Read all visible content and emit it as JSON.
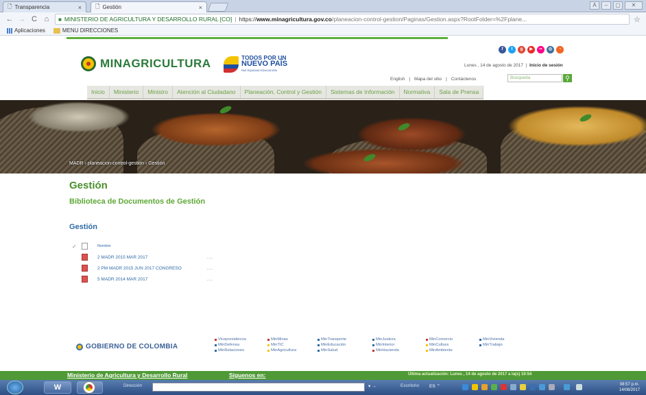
{
  "browser": {
    "tabs": [
      {
        "label": "Transparencia",
        "close": "×"
      },
      {
        "label": "Gestión",
        "close": "×"
      }
    ],
    "window_controls": [
      "A",
      "–",
      "▢",
      "✕"
    ],
    "nav": {
      "back": "←",
      "forward": "→",
      "reload": "C",
      "home": "⌂"
    },
    "site_name": "MINISTERIO DE AGRICULTURA Y DESARROLLO RURAL [CO]",
    "separator": "|",
    "url_scheme": "https://",
    "url_host": "www.minagricultura.gov.co",
    "url_path": "/planeacion-control-gestion/Paginas/Gestion.aspx?RootFolder=%2Fplane...",
    "bookmark_star": "☆",
    "bookmarks": [
      {
        "label": "Aplicaciones"
      },
      {
        "label": "MENU DIRECCIONES"
      }
    ]
  },
  "header": {
    "logo_text": "MINAGRICULTURA",
    "todos_line1": "TODOS POR UN",
    "todos_line2": "NUEVO PAÍS",
    "todos_line3": "PAZ EQUIDAD EDUCACIÓN",
    "social": [
      {
        "name": "facebook-icon",
        "glyph": "f",
        "color": "#3b5998"
      },
      {
        "name": "twitter-icon",
        "glyph": "t",
        "color": "#1da1f2"
      },
      {
        "name": "googleplus-icon",
        "glyph": "g",
        "color": "#dd4b39"
      },
      {
        "name": "youtube-icon",
        "glyph": "▶",
        "color": "#e52d27"
      },
      {
        "name": "flickr-icon",
        "glyph": "••",
        "color": "#ff0084"
      },
      {
        "name": "instagram-icon",
        "glyph": "◎",
        "color": "#3f729b"
      },
      {
        "name": "rss-icon",
        "glyph": "◔",
        "color": "#f26522"
      }
    ],
    "date": "Lunes , 14 de agosto de 2017",
    "session_link": "Inicio de sesión",
    "top_links": [
      "English",
      "Mapa del sitio",
      "Contáctenos"
    ],
    "search_placeholder": "Búsqueda",
    "search_icon": "⚲"
  },
  "menu": [
    "Inicio",
    "Ministerio",
    "Ministro",
    "Atención al Ciudadano",
    "Planeación, Control y Gestión",
    "Sistemas de Información",
    "Normativa",
    "Sala de Prensa"
  ],
  "breadcrumb": {
    "items": [
      "MADR",
      "planeacion-control-gestion",
      "Gestión"
    ],
    "sep": "›"
  },
  "content": {
    "title": "Gestión",
    "subtitle": "Biblioteca de Documentos de Gestión",
    "section": "Gestión",
    "header_check": "✓",
    "column_name": "Nombre",
    "docs": [
      {
        "name": "2 MADR 2015 MAR 2017",
        "menu": "..."
      },
      {
        "name": "2 PM MADR 2015 JUN 2017 CONGRESO",
        "menu": "..."
      },
      {
        "name": "5 MADR 2014 MAR 2017",
        "menu": "..."
      }
    ]
  },
  "footer": {
    "gobierno": "GOBIERNO DE COLOMBIA",
    "ministries": [
      {
        "label": "Vicepresidencia",
        "color": "#c0392b"
      },
      {
        "label": "MinMinas",
        "color": "#c0392b"
      },
      {
        "label": "MinTransporte",
        "color": "#2e6aa6"
      },
      {
        "label": "MinJusticia",
        "color": "#2e6aa6"
      },
      {
        "label": "MinComercio",
        "color": "#c0392b"
      },
      {
        "label": "MinVivienda",
        "color": "#2e6aa6"
      },
      {
        "label": "MinDefensa",
        "color": "#2e6aa6"
      },
      {
        "label": "MinTIC",
        "color": "#f4c300"
      },
      {
        "label": "MinEducación",
        "color": "#2e6aa6"
      },
      {
        "label": "MinInterior",
        "color": "#2e6aa6"
      },
      {
        "label": "MinCultura",
        "color": "#f4c300"
      },
      {
        "label": "MinTrabajo",
        "color": "#2e6aa6"
      },
      {
        "label": "MinRelaciones",
        "color": "#2e6aa6"
      },
      {
        "label": "MinAgricultura",
        "color": "#f4c300"
      },
      {
        "label": "MinSalud",
        "color": "#2e6aa6"
      },
      {
        "label": "MinHacienda",
        "color": "#c0392b"
      },
      {
        "label": "MinAmbiente",
        "color": "#f4c300"
      }
    ],
    "bar_left": "Ministerio de Agricultura y Desarrollo Rural",
    "bar_follow": "Síguenos en:",
    "last_update": "Última actualización: Lunes , 14 de agosto de 2017 a la(s) 10:54"
  },
  "taskbar": {
    "word_label": "W",
    "address_label": "Dirección",
    "go_label": "▾ →",
    "desktop_label": "Escritorio",
    "tray_label": "ES ⌃",
    "clock_time": "08:57 p.m.",
    "clock_date": "14/08/2017"
  }
}
